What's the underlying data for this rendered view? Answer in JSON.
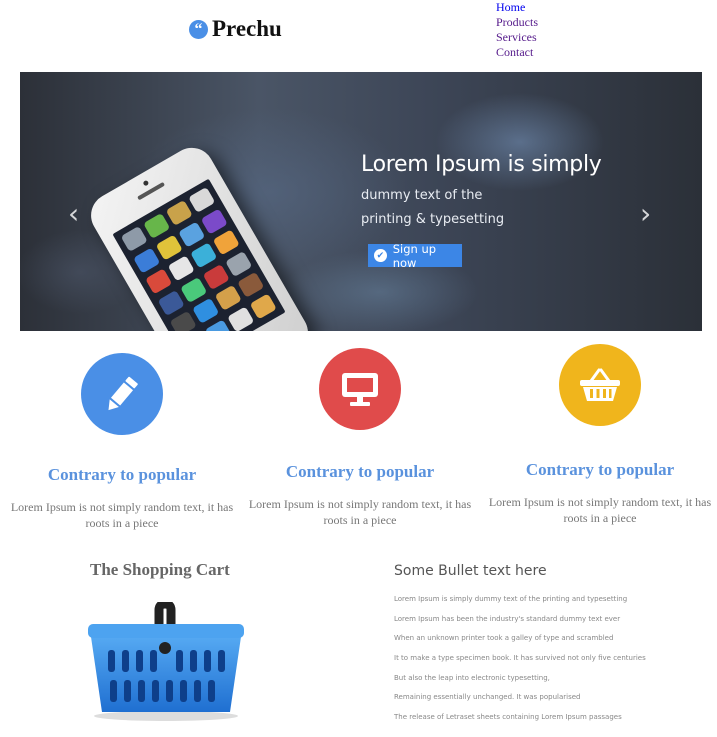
{
  "header": {
    "logo_glyph": "“",
    "logo_text": "Prechu",
    "nav": [
      "Home",
      "Products",
      "Services",
      "Contact"
    ]
  },
  "hero": {
    "headline": "Lorem Ipsum is simply",
    "subline_1": "dummy text of the",
    "subline_2": "printing & typesetting",
    "cta_label": "Sign up now",
    "prev_glyph": "‹",
    "next_glyph": "›"
  },
  "features": [
    {
      "icon": "pencil-icon",
      "color": "#4a8fe6",
      "title": "Contrary to popular",
      "text": "Lorem Ipsum is not simply random text, it has roots in a piece"
    },
    {
      "icon": "monitor-icon",
      "color": "#e04b4b",
      "title": "Contrary to popular",
      "text": "Lorem Ipsum is not simply random text, it has roots in a piece"
    },
    {
      "icon": "basket-icon",
      "color": "#f0b51c",
      "title": "Contrary to popular",
      "text": "Lorem Ipsum is not simply random text, it has roots in a piece"
    }
  ],
  "cart": {
    "title": "The Shopping Cart"
  },
  "bullets": {
    "title": "Some Bullet text here",
    "items": [
      "Lorem Ipsum is simply dummy text of the printing and typesetting",
      "Lorem Ipsum has been the industry's standard dummy text ever",
      "When an unknown printer took a galley of type and scrambled",
      "It to make a type specimen book. It has survived not only five centuries",
      "But also the leap into electronic typesetting,",
      "Remaining essentially unchanged. It was popularised",
      "The release of Letraset sheets containing Lorem Ipsum passages"
    ]
  }
}
